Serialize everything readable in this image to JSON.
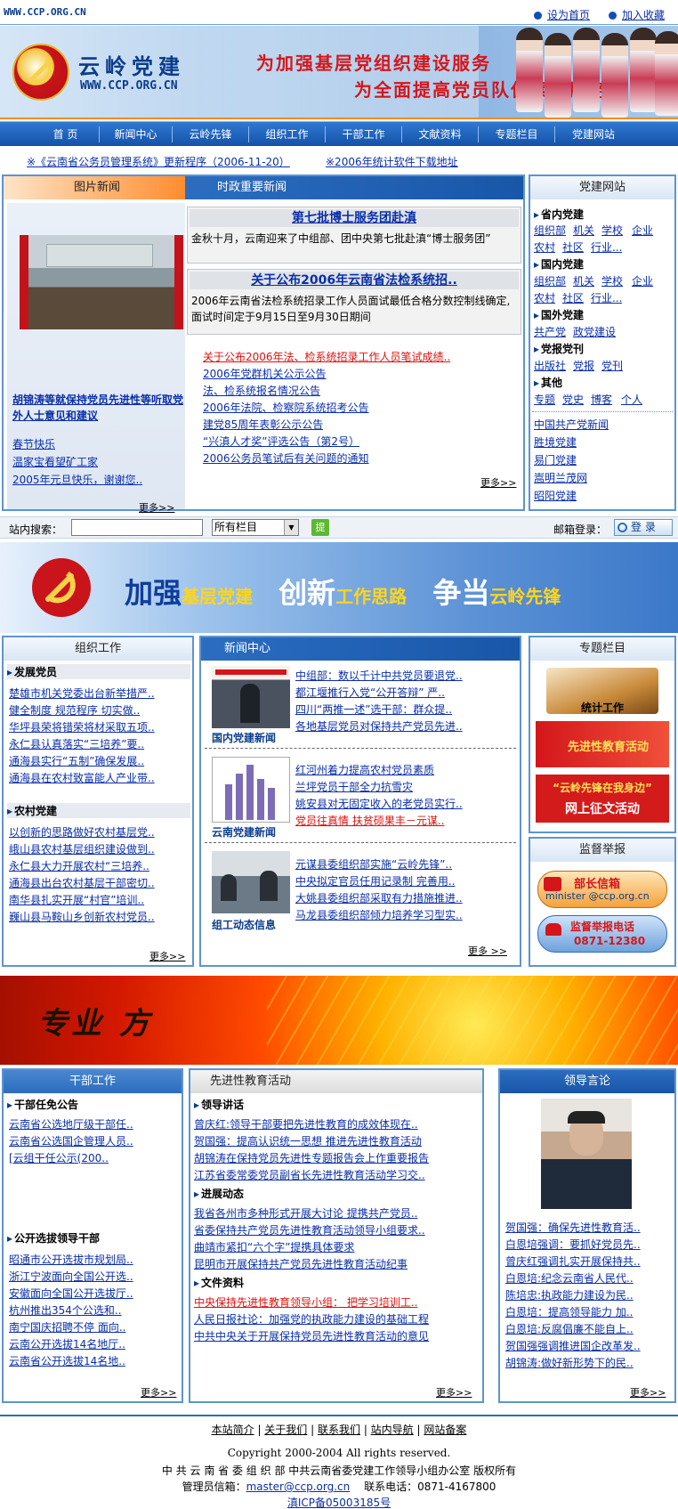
{
  "top": {
    "url": "WWW.CCP.ORG.CN",
    "set_home": "设为首页",
    "add_fav": "加入收藏"
  },
  "header": {
    "name": "云岭党建",
    "url": "WWW.CCP.ORG.CN",
    "slogan1": "为加强基层党组织建设服务",
    "slogan2": "为全面提高党员队伍素质服务"
  },
  "nav": [
    "首 页",
    "新闻中心",
    "云岭先锋",
    "组织工作",
    "干部工作",
    "文献资料",
    "专题栏目",
    "党建网站"
  ],
  "notice": {
    "item1": "※《云南省公务员管理系统》更新程序（2006-11-20）",
    "item2": "※2006年统计软件下载地址"
  },
  "picnews": {
    "tab": "图片新闻",
    "caption": "胡锦涛等就保持党员先进性等听取党外人士意见和建议",
    "links": [
      "春节快乐",
      "温家宝看望矿工家",
      "2005年元旦快乐，谢谢您.."
    ],
    "more": "更多>>"
  },
  "politics": {
    "tab": "时政重要新闻",
    "headline1": "第七批博士服务团赴滇",
    "text1": "金秋十月，云南迎来了中组部、团中央第七批赴滇“博士服务团”",
    "headline2": "关于公布2006年云南省法检系统招..",
    "text2": "2006年云南省法检系统招录工作人员面试最低合格分数控制线确定,面试时间定于9月15日至9月30日期间",
    "links": [
      "关于公布2006年法、检系统招录工作人员笔试成绩..",
      "2006年党群机关公示公告",
      "法、检系统报名情况公告",
      "2006年法院、检察院系统招考公告",
      "建党85周年表彰公示公告",
      "“兴滇人才奖”评选公告（第2号）",
      "2006公务员笔试后有关问题的通知"
    ],
    "more": "更多>>"
  },
  "sites": {
    "title": "党建网站",
    "groups": [
      {
        "label": "省内党建",
        "links": [
          "组织部",
          "机关",
          "学校",
          "企业",
          "农村",
          "社区",
          "行业..."
        ]
      },
      {
        "label": "国内党建",
        "links": [
          "组织部",
          "机关",
          "学校",
          "企业",
          "农村",
          "社区",
          "行业..."
        ]
      },
      {
        "label": "国外党建",
        "links": [
          "共产党",
          "政党建设"
        ]
      },
      {
        "label": "党报党刊",
        "links": [
          "出版社",
          "党报",
          "党刊"
        ]
      },
      {
        "label": "其他",
        "links": [
          "专题",
          "党史",
          "博客",
          "个人"
        ]
      }
    ],
    "list": [
      "中国共产党新闻",
      "胜境党建",
      "易门党建",
      "嵩明兰茂网",
      "昭阳党建"
    ]
  },
  "search": {
    "label": "站内搜索：",
    "input": "",
    "select": "所有栏目",
    "go": "提",
    "mail_label": "邮箱登录：",
    "login": "登 录"
  },
  "banner2": {
    "t1": "加强",
    "t2": "基层党建",
    "t3": "创新",
    "t4": "工作思路",
    "t5": "争当",
    "t6": "云岭先锋"
  },
  "org": {
    "title": "组织工作",
    "sec1": "发展党员",
    "links1": [
      "楚雄市机关党委出台新举措严..",
      "健全制度 规范程序 切实做..",
      "华坪县荣将错荣将材采取五项..",
      "永仁县认真落实“三培养”要..",
      "通海县实行“五制”确保发展..",
      "通海县在农村致富能人产业带.."
    ],
    "sec2": "农村党建",
    "links2": [
      "以创新的思路做好农村基层党..",
      "峨山县农村基层组织建设做到..",
      "永仁县大力开展农村“三培养..",
      "通海县出台农村基层干部密切..",
      "南华县扎实开展“村官”培训..",
      "巍山县马鞍山乡创新农村党员.."
    ],
    "more": "更多>>"
  },
  "newscenter": {
    "title": "新闻中心",
    "cap1": "国内党建新闻",
    "cap2": "云南党建新闻",
    "cap3": "组工动态信息",
    "links1": [
      "中组部：数以千计中共党员要退党..",
      "都江堰推行入党“公开答辩” 严..",
      "四川“两推一述”选干部：群众提..",
      "各地基层党员对保持共产党员先进.."
    ],
    "links2": [
      "红河州着力提高农村党员素质",
      "兰坪党员干部全力抗雪灾",
      "姚安县对无固定收入的老党员实行..",
      "党员往真情 扶贫硕果丰－元谋.."
    ],
    "links3": [
      "元谋县委组织部实施“云岭先锋”..",
      "中央拟定官员任用记录制 完善用..",
      "大姚县委组织部采取有力措施推进..",
      "马龙县委组织部倾力培养学习型实.."
    ],
    "more": "更多 >>"
  },
  "special": {
    "title": "专题栏目",
    "item1": "统计工作",
    "item2": "先进性教育活动",
    "item3a": "“云岭先锋在我身边”",
    "item3b": "网上征文活动"
  },
  "report": {
    "title": "监督举报",
    "mail_title": "部长信箱",
    "mail_addr": "minister @ccp.org.cn",
    "tel_title": "监督举报电话",
    "tel": "0871-12380"
  },
  "banner3": {
    "text": "专业 方"
  },
  "cadre": {
    "title": "干部工作",
    "sec1": "干部任免公告",
    "links1": [
      "云南省公选地厅级干部任..",
      "云南省公选国企管理人员..",
      "[云组干任公示(200.."
    ],
    "sec2": "公开选拔领导干部",
    "links2": [
      "昭通市公开选拔市规划局..",
      "浙江宁波面向全国公开选..",
      "安徽面向全国公开选拔厅..",
      "杭州推出354个公选和..",
      "南宁国庆招聘不停 面向..",
      "云南公开选拔14名地厅..",
      "云南省公开选拔14名地.."
    ],
    "more": "更多>>"
  },
  "edu": {
    "title": "先进性教育活动",
    "sec1": "领导讲话",
    "links1": [
      "曾庆红:领导干部要把先进性教育的成效体现在..",
      "贺国强：提高认识统一思想 推进先进性教育活动",
      "胡锦涛在保持党员先进性专题报告会上作重要报告",
      "江苏省委常委党员副省长先进性教育活动学习交.."
    ],
    "sec2": "进展动态",
    "links2": [
      "我省各州市多种形式开展大讨论 提携共产党员..",
      "省委保持共产党员先进性教育活动领导小组要求..",
      "曲靖市紧扣“六个字”提携具体要求",
      "昆明市开展保持共产党员先进性教育活动纪事"
    ],
    "sec3": "文件资料",
    "links3": [
      "中央保持先进性教育领导小组： 把学习培训工..",
      "人民日报社论：加强党的执政能力建设的基础工程",
      "中共中央关于开展保持党员先进性教育活动的意见"
    ],
    "more": "更多>>"
  },
  "speech": {
    "title": "领导言论",
    "links": [
      "贺国强：确保先进性教育活..",
      "白恩培强调：要抓好党员先..",
      "曾庆红强调扎实开展保持共..",
      "白恩培:纪念云南省人民代..",
      "陈培忠:执政能力建设为民..",
      "白恩培：提高领导能力 加..",
      "白恩培:反腐倡廉不能自上..",
      "贺国强强调推进国企改革发..",
      "胡锦涛:做好新形势下的民.."
    ],
    "more": "更多>>"
  },
  "footer": {
    "links": [
      "本站简介",
      "关于我们",
      "联系我们",
      "站内导航",
      "网站备案"
    ],
    "copy": "Copyright 2000-2004 All rights reserved.",
    "org": "中 共 云 南 省 委 组 织 部 中共云南省委党建工作领导小组办公室 版权所有",
    "admin_label": "管理员信箱：",
    "admin_mail": "master@ccp.org.cn",
    "tel": "联系电话：0871-4167800",
    "icp": "滇ICP备05003185号"
  },
  "colors": {
    "nav": "#1552a8",
    "border": "#5d94d2",
    "red": "#e0100d",
    "link": "#0a2ea8"
  }
}
